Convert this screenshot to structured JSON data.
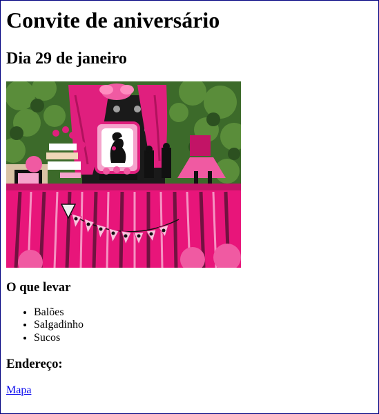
{
  "page": {
    "title": "Convite de aniversário",
    "date": "Dia 29 de janeiro",
    "photo_alt": "party-photo",
    "bring_heading": "O que levar",
    "bring_items": [
      "Balões",
      "Salgadinho",
      "Sucos"
    ],
    "address_heading": "Endereço:",
    "map_link": "Mapa"
  },
  "colors": {
    "link": "#0000ee",
    "hot_pink": "#e8157a",
    "light_pink": "#f39ac8",
    "foliage": "#3f6d2a",
    "black": "#111111"
  }
}
